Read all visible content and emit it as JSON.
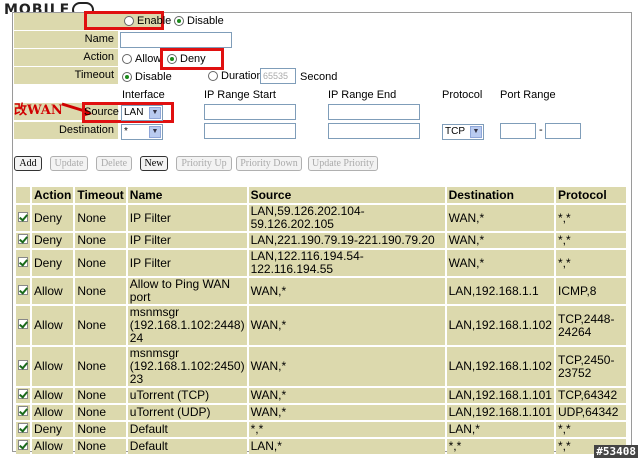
{
  "logo": {
    "text": "MOBILE"
  },
  "form": {
    "rule_enable": "Enable",
    "rule_disable": "Disable",
    "name_label": "Name",
    "action_label": "Action",
    "action_allow": "Allow",
    "action_deny": "Deny",
    "timeout_label": "Timeout",
    "timeout_disable": "Disable",
    "timeout_duration": "Duration",
    "duration_value": "65535",
    "second_label": "Second",
    "col_interface": "Interface",
    "col_ip_start": "IP Range Start",
    "col_ip_end": "IP Range End",
    "col_protocol": "Protocol",
    "col_port_range": "Port Range",
    "annotation": "改WAN",
    "source_label": "Source",
    "source_value": "LAN",
    "destination_label": "Destination",
    "destination_value": "*",
    "protocol_value": "TCP",
    "port_sep": "-"
  },
  "buttons": {
    "add": "Add",
    "update": "Update",
    "delete": "Delete",
    "new": "New",
    "priority_up": "Priority Up",
    "priority_down": "Priority Down",
    "update_priority": "Update Priority"
  },
  "table": {
    "headers": [
      "Action",
      "Timeout",
      "Name",
      "Source",
      "Destination",
      "Protocol"
    ],
    "rows": [
      {
        "action": "Deny",
        "timeout": "None",
        "name": "IP Filter",
        "source": "LAN,59.126.202.104-59.126.202.105",
        "destination": "WAN,*",
        "protocol": "*,*"
      },
      {
        "action": "Deny",
        "timeout": "None",
        "name": "IP Filter",
        "source": "LAN,221.190.79.19-221.190.79.20",
        "destination": "WAN,*",
        "protocol": "*,*"
      },
      {
        "action": "Deny",
        "timeout": "None",
        "name": "IP Filter",
        "source": "LAN,122.116.194.54-122.116.194.55",
        "destination": "WAN,*",
        "protocol": "*,*"
      },
      {
        "action": "Allow",
        "timeout": "None",
        "name": "Allow to Ping WAN port",
        "source": "WAN,*",
        "destination": "LAN,192.168.1.1",
        "protocol": "ICMP,8"
      },
      {
        "action": "Allow",
        "timeout": "None",
        "name": "msnmsgr (192.168.1.102:2448) 24",
        "source": "WAN,*",
        "destination": "LAN,192.168.1.102",
        "protocol": "TCP,2448-24264"
      },
      {
        "action": "Allow",
        "timeout": "None",
        "name": "msnmsgr (192.168.1.102:2450) 23",
        "source": "WAN,*",
        "destination": "LAN,192.168.1.102",
        "protocol": "TCP,2450-23752"
      },
      {
        "action": "Allow",
        "timeout": "None",
        "name": "uTorrent (TCP)",
        "source": "WAN,*",
        "destination": "LAN,192.168.1.101",
        "protocol": "TCP,64342"
      },
      {
        "action": "Allow",
        "timeout": "None",
        "name": "uTorrent (UDP)",
        "source": "WAN,*",
        "destination": "LAN,192.168.1.101",
        "protocol": "UDP,64342"
      },
      {
        "action": "Deny",
        "timeout": "None",
        "name": "Default",
        "source": "*,*",
        "destination": "LAN,*",
        "protocol": "*,*"
      },
      {
        "action": "Allow",
        "timeout": "None",
        "name": "Default",
        "source": "LAN,*",
        "destination": "*,*",
        "protocol": "*,*"
      }
    ]
  },
  "watermark": "#53408"
}
